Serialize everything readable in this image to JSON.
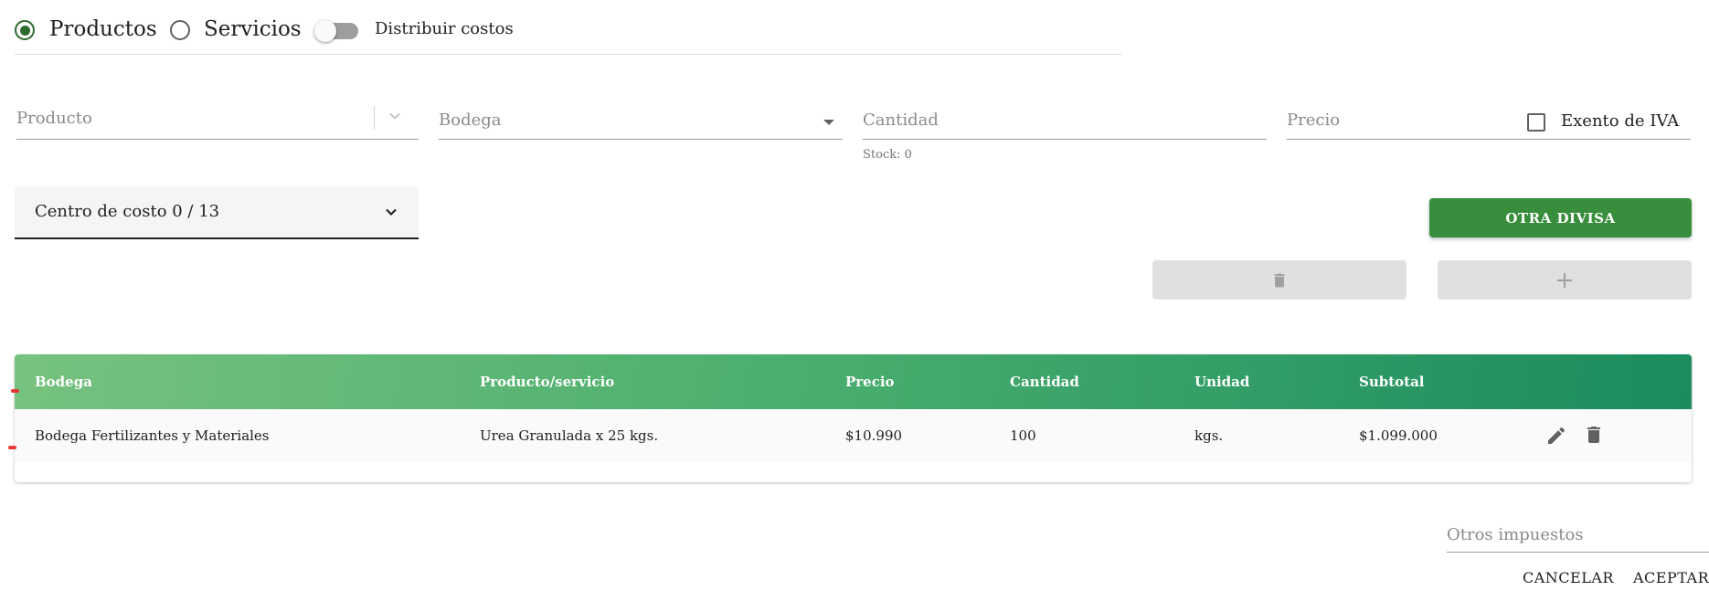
{
  "type_selector": {
    "options": [
      {
        "label": "Productos",
        "selected": true
      },
      {
        "label": "Servicios",
        "selected": false
      }
    ],
    "distribute_costs": {
      "label": "Distribuir costos",
      "enabled": false
    }
  },
  "form": {
    "producto": {
      "label": "Producto"
    },
    "bodega": {
      "label": "Bodega"
    },
    "cantidad": {
      "label": "Cantidad",
      "hint": "Stock: 0"
    },
    "precio": {
      "label": "Precio"
    },
    "exento_iva": {
      "label": "Exento de IVA",
      "checked": false
    },
    "centro_costo": {
      "value": "Centro de costo 0 / 13"
    }
  },
  "buttons": {
    "other_currency": "OTRA DIVISA",
    "cancel": "CANCELAR",
    "accept": "ACEPTAR"
  },
  "table": {
    "columns": [
      "Bodega",
      "Producto/servicio",
      "Precio",
      "Cantidad",
      "Unidad",
      "Subtotal"
    ],
    "rows": [
      {
        "bodega": "Bodega Fertilizantes y Materiales",
        "producto": "Urea Granulada x 25 kgs.",
        "precio": "$10.990",
        "cantidad": "100",
        "unidad": "kgs.",
        "subtotal": "$1.099.000"
      }
    ]
  },
  "otros_impuestos": {
    "label": "Otros impuestos"
  },
  "colors": {
    "primary_green": "#388e3c",
    "radio_green": "#2e6b30",
    "header_gradient_start": "#77c27f",
    "header_gradient_end": "#1a8c5e"
  }
}
